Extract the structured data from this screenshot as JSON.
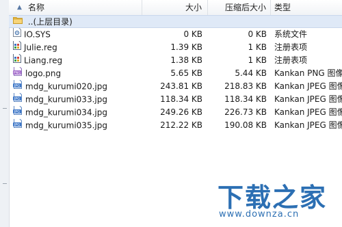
{
  "columns": {
    "name": "名称",
    "size": "大小",
    "compressed": "压缩后大小",
    "type": "类型"
  },
  "parent_row": {
    "label": "..(上层目录)",
    "icon": "folder-icon"
  },
  "files": [
    {
      "name": "IO.SYS",
      "size": "0 KB",
      "compressed": "0 KB",
      "type": "系统文件",
      "icon": "system-file-icon"
    },
    {
      "name": "Julie.reg",
      "size": "1.39 KB",
      "compressed": "1 KB",
      "type": "注册表项",
      "icon": "registry-file-icon"
    },
    {
      "name": "Liang.reg",
      "size": "1.38 KB",
      "compressed": "1 KB",
      "type": "注册表项",
      "icon": "registry-file-icon"
    },
    {
      "name": "logo.png",
      "size": "5.65 KB",
      "compressed": "5.44 KB",
      "type": "Kankan PNG 图像",
      "icon": "png-file-icon"
    },
    {
      "name": "mdg_kurumi020.jpg",
      "size": "243.81 KB",
      "compressed": "218.83 KB",
      "type": "Kankan JPEG 图像",
      "icon": "jpg-file-icon"
    },
    {
      "name": "mdg_kurumi033.jpg",
      "size": "118.34 KB",
      "compressed": "118.34 KB",
      "type": "Kankan JPEG 图像",
      "icon": "jpg-file-icon"
    },
    {
      "name": "mdg_kurumi034.jpg",
      "size": "249.26 KB",
      "compressed": "226.73 KB",
      "type": "Kankan JPEG 图像",
      "icon": "jpg-file-icon"
    },
    {
      "name": "mdg_kurumi035.jpg",
      "size": "212.22 KB",
      "compressed": "190.08 KB",
      "type": "Kankan JPEG 图像",
      "icon": "jpg-file-icon"
    }
  ],
  "watermark": {
    "title": "下载之家",
    "url": "www.downza.cn"
  },
  "colors": {
    "selection": "#dfe9f7",
    "watermark": "#2c6fb3"
  }
}
